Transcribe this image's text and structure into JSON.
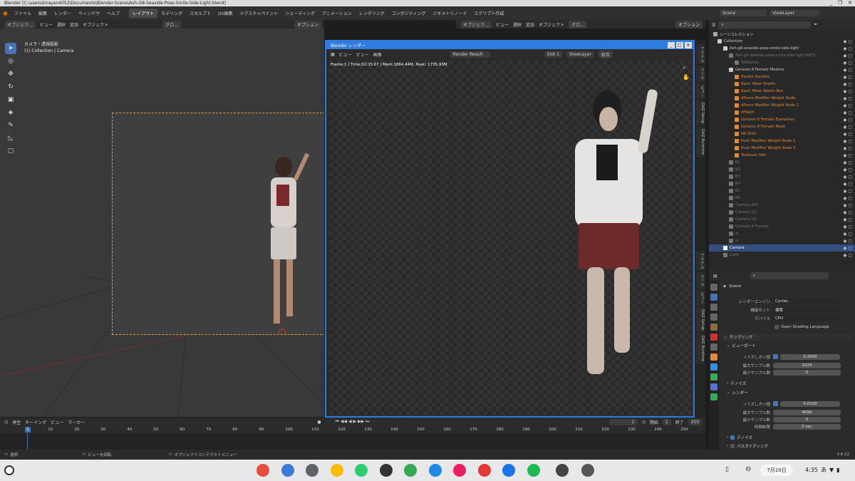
{
  "titlebar": {
    "title": "Blender [C:\\users\\kirayan4052\\Documents\\Blender-Scene\\Ash-G8-Seaside-Pose-Smile-Side-Light.blend]",
    "min": "_",
    "max": "❐",
    "close": "✕"
  },
  "menubar": {
    "menus": [
      "ファイル",
      "編集",
      "レンダー",
      "ウィンドウ",
      "ヘルプ"
    ],
    "workspaces": [
      "レイアウト",
      "モデリング",
      "スカルプト",
      "UV編集",
      "テクスチャペイント",
      "シェーディング",
      "アニメーション",
      "レンダリング",
      "コンポジティング",
      "ジオメトリノード",
      "スクリプト作成"
    ],
    "active_workspace": "レイアウト",
    "scene_label": "Scene",
    "viewlayer_label": "ViewLayer"
  },
  "viewport": {
    "header_items": [
      "オブジェク…",
      "ビュー",
      "選択",
      "追加",
      "オブジェクト"
    ],
    "transform": "グロ…",
    "options": "オプション",
    "info_line1": "カメラ・透視投影",
    "info_line2": "(1) Collection | Camera",
    "tools": [
      "select-tool",
      "cursor-tool",
      "move-tool",
      "rotate-tool",
      "scale-tool",
      "transform-tool",
      "annotate-tool",
      "measure-tool",
      "add-cube-tool"
    ]
  },
  "render_window": {
    "title": "Blender レンダー",
    "menus": [
      "ビュー",
      "ビュー",
      "画像"
    ],
    "image_name": "Render Result",
    "slot": "Slot 1",
    "viewlayer": "ViewLayer",
    "pass": "統合",
    "stats": "Frame:1 | Time:02:35.07 | Mem:1664.44M, Peak: 1735.93M"
  },
  "right_viewport_header": {
    "items": [
      "オブジェク…",
      "ビュー",
      "選択",
      "追加",
      "オブジェクト"
    ],
    "transform": "グロ…",
    "options": "オプション"
  },
  "side_tabs": [
    "アイテム",
    "ツール",
    "ビュー",
    "DAZ Setup",
    "DAZ Runtime"
  ],
  "side_tabs_lower": [
    "アイテム",
    "ツール",
    "ビュー",
    "DAZ Setup",
    "DAZ Runtime"
  ],
  "outliner": {
    "root": "シーンコレクション",
    "rows": [
      {
        "label": "Collection",
        "indent": 0,
        "color": "#cccccc"
      },
      {
        "label": "Ash-g8-seaside-pose-smile-side-light",
        "indent": 1,
        "color": "#cccccc"
      },
      {
        "label": "Ash-g8-seaside-pose-smile-side-light REFS",
        "indent": 2,
        "color": "#777777"
      },
      {
        "label": "NSillution",
        "indent": 3,
        "color": "#777777"
      },
      {
        "label": "Genesis 8 Female Meshes",
        "indent": 2,
        "color": "#cccccc"
      },
      {
        "label": "Bardot Sendals",
        "indent": 3,
        "color": "#e08a3c"
      },
      {
        "label": "Basic Wear Shorts",
        "indent": 3,
        "color": "#e08a3c"
      },
      {
        "label": "Basic Wear Sports Bra",
        "indent": 3,
        "color": "#e08a3c"
      },
      {
        "label": "dForce Modifier Weight Node",
        "indent": 3,
        "color": "#e08a3c"
      },
      {
        "label": "dForce Modifier Weight Node 1",
        "indent": 3,
        "color": "#e08a3c"
      },
      {
        "label": "dFSkirt",
        "indent": 3,
        "color": "#e08a3c"
      },
      {
        "label": "Genesis 8 Female Eyelashes",
        "indent": 3,
        "color": "#e08a3c"
      },
      {
        "label": "Genesis 8 Female Mesh",
        "indent": 3,
        "color": "#e08a3c"
      },
      {
        "label": "NS Shirt",
        "indent": 3,
        "color": "#e08a3c"
      },
      {
        "label": "Push Modifier Weight Node 1",
        "indent": 3,
        "color": "#e08a3c"
      },
      {
        "label": "Push Modifier Weight Node 3",
        "indent": 3,
        "color": "#e08a3c"
      },
      {
        "label": "Toulouse Hair",
        "indent": 3,
        "color": "#e08a3c"
      },
      {
        "label": "B1",
        "indent": 2,
        "color": "#777777"
      },
      {
        "label": "B2",
        "indent": 2,
        "color": "#777777"
      },
      {
        "label": "B3",
        "indent": 2,
        "color": "#777777"
      },
      {
        "label": "B4",
        "indent": 2,
        "color": "#777777"
      },
      {
        "label": "B5",
        "indent": 2,
        "color": "#777777"
      },
      {
        "label": "B6",
        "indent": 2,
        "color": "#777777"
      },
      {
        "label": "Camera.001",
        "indent": 2,
        "color": "#777777"
      },
      {
        "label": "Camera (2)",
        "indent": 2,
        "color": "#777777"
      },
      {
        "label": "Camera (3)",
        "indent": 2,
        "color": "#777777"
      },
      {
        "label": "Genesis 8 Female",
        "indent": 2,
        "color": "#777777"
      },
      {
        "label": "sl",
        "indent": 2,
        "color": "#777777"
      },
      {
        "label": "sr",
        "indent": 2,
        "color": "#777777"
      },
      {
        "label": "Camera",
        "indent": 1,
        "color": "#ffffff",
        "selected": true
      },
      {
        "label": "Light",
        "indent": 1,
        "color": "#777777"
      }
    ]
  },
  "properties": {
    "scene_name": "Scene",
    "render_engine_label": "レンダーエンジン",
    "render_engine": "Cycles",
    "feature_set_label": "機能セット",
    "feature_set": "標準",
    "device_label": "デバイス",
    "device": "CPU",
    "osl": "Open Shading Language",
    "sampling": "サンプリング",
    "viewport_section": "ビューポート",
    "noise_threshold_label": "ノイズしきい値",
    "vp_noise_threshold": "0.1000",
    "max_samples_label": "最大サンプル数",
    "vp_max_samples": "1024",
    "min_samples_label": "最小サンプル数",
    "vp_min_samples": "0",
    "denoise": "デノイズ",
    "render_section": "レンダー",
    "r_noise_threshold": "0.0100",
    "r_max_samples": "4096",
    "r_min_samples": "0",
    "time_limit_label": "時間制限",
    "time_limit": "0 sec",
    "denoise2": "デノイズ",
    "path_guiding": "パスガイディング"
  },
  "timeline": {
    "menus": [
      "再生",
      "キーイング",
      "ビュー",
      "マーカー"
    ],
    "current_frame": "1",
    "start_label": "開始",
    "start": "1",
    "end_label": "終了",
    "end": "250",
    "ticks": [
      "1",
      "10",
      "20",
      "30",
      "40",
      "50",
      "60",
      "70",
      "80",
      "90",
      "100",
      "110",
      "120",
      "130",
      "140",
      "150",
      "160",
      "170",
      "180",
      "190",
      "200",
      "210",
      "220",
      "230",
      "240",
      "250"
    ]
  },
  "statusbar": {
    "select": "選択",
    "rotate": "ビューを回転",
    "context": "オブジェクトコンテクストメニュー",
    "version": "3.6.12"
  },
  "shelf": {
    "date": "7月10日",
    "time": "4:35",
    "ime": "あ",
    "apps": [
      "launcher",
      "chrome",
      "files",
      "settings",
      "photos",
      "terminal-dev",
      "terminal",
      "play-store",
      "feedly",
      "app-pink",
      "anydesk",
      "docs",
      "spotify",
      "penguin-1",
      "penguin-2"
    ],
    "app_colors": [
      "#ffffff",
      "#e74c3c",
      "#3a7bd5",
      "#5f6368",
      "#fbbc05",
      "#2ecc71",
      "#333333",
      "#34a853",
      "#1e88e5",
      "#e91e63",
      "#e53935",
      "#1a73e8",
      "#1db954",
      "#444444",
      "#555555"
    ]
  }
}
